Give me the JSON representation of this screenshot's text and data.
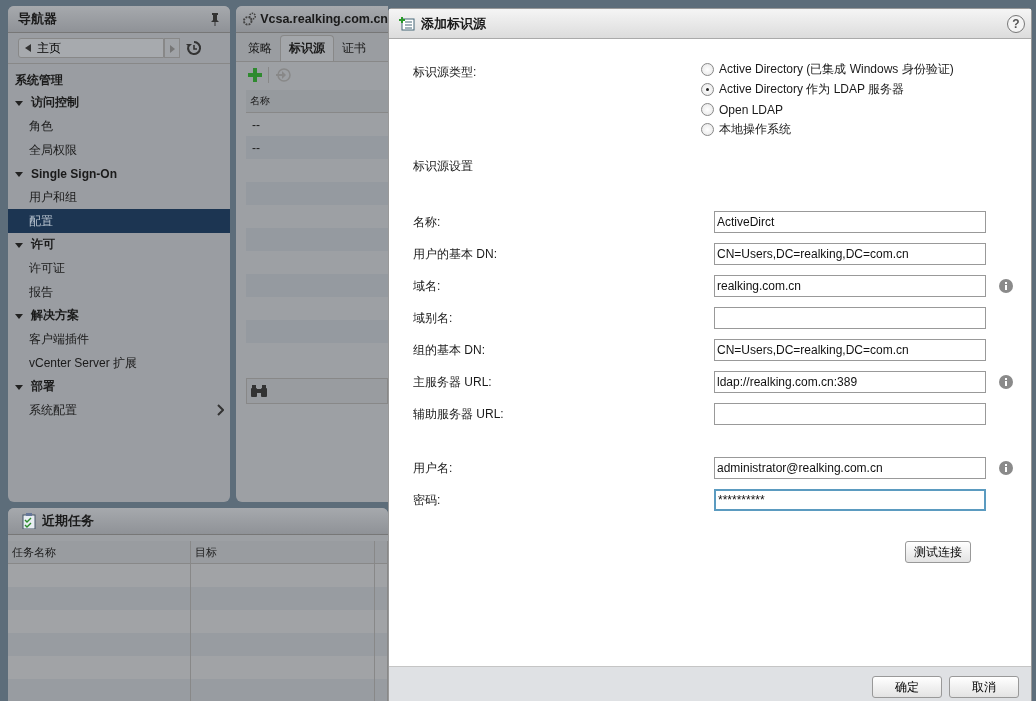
{
  "navigator": {
    "title": "导航器",
    "home": "主页",
    "section": "系统管理",
    "groups": [
      {
        "label": "访问控制",
        "expanded": true,
        "children": [
          {
            "label": "角色",
            "selected": false,
            "has_submenu": false
          },
          {
            "label": "全局权限",
            "selected": false,
            "has_submenu": false
          }
        ]
      },
      {
        "label": "Single Sign-On",
        "expanded": true,
        "children": [
          {
            "label": "用户和组",
            "selected": false,
            "has_submenu": false
          },
          {
            "label": "配置",
            "selected": true,
            "has_submenu": false
          }
        ]
      },
      {
        "label": "许可",
        "expanded": true,
        "children": [
          {
            "label": "许可证",
            "selected": false,
            "has_submenu": false
          },
          {
            "label": "报告",
            "selected": false,
            "has_submenu": false
          }
        ]
      },
      {
        "label": "解决方案",
        "expanded": true,
        "children": [
          {
            "label": "客户端插件",
            "selected": false,
            "has_submenu": false
          },
          {
            "label": "vCenter Server 扩展",
            "selected": false,
            "has_submenu": false
          }
        ]
      },
      {
        "label": "部署",
        "expanded": true,
        "children": [
          {
            "label": "系统配置",
            "selected": false,
            "has_submenu": true
          }
        ]
      }
    ]
  },
  "main": {
    "title": "Vcsa.realking.com.cn",
    "tabs": [
      {
        "label": "策略",
        "selected": false
      },
      {
        "label": "标识源",
        "selected": true
      },
      {
        "label": "证书",
        "selected": false
      }
    ],
    "table": {
      "columns": [
        "名称"
      ],
      "rows": [
        [
          "--"
        ],
        [
          "--"
        ]
      ]
    }
  },
  "recent_tasks": {
    "title": "近期任务",
    "columns": [
      "任务名称",
      "目标"
    ]
  },
  "dialog": {
    "title": "添加标识源",
    "help": "?",
    "type_label": "标识源类型:",
    "types": [
      {
        "label": "Active Directory (已集成 Windows 身份验证)",
        "selected": false
      },
      {
        "label": "Active Directory 作为 LDAP 服务器",
        "selected": true
      },
      {
        "label": "Open LDAP",
        "selected": false
      },
      {
        "label": "本地操作系统",
        "selected": false
      }
    ],
    "settings_heading": "标识源设置",
    "server_fields": [
      {
        "label": "名称:",
        "value": "ActiveDirct",
        "info": false,
        "focused": false
      },
      {
        "label": "用户的基本 DN:",
        "value": "CN=Users,DC=realking,DC=com.cn",
        "info": false,
        "focused": false
      },
      {
        "label": "域名:",
        "value": "realking.com.cn",
        "info": true,
        "focused": false
      },
      {
        "label": "域别名:",
        "info": false,
        "focused": false
      },
      {
        "label": "组的基本 DN:",
        "value": "CN=Users,DC=realking,DC=com.cn",
        "info": false,
        "focused": false
      },
      {
        "label": "主服务器 URL:",
        "value": "ldap://realking.com.cn:389",
        "info": true,
        "focused": false
      },
      {
        "label": "辅助服务器 URL:",
        "info": false,
        "focused": false
      }
    ],
    "account_fields": [
      {
        "label": "用户名:",
        "value": "administrator@realking.com.cn",
        "info": true,
        "focused": false
      },
      {
        "label": "密码:",
        "value": "**********",
        "info": false,
        "focused": true
      }
    ],
    "test_button": "测试连接",
    "buttons": [
      "确定",
      "取消"
    ]
  }
}
